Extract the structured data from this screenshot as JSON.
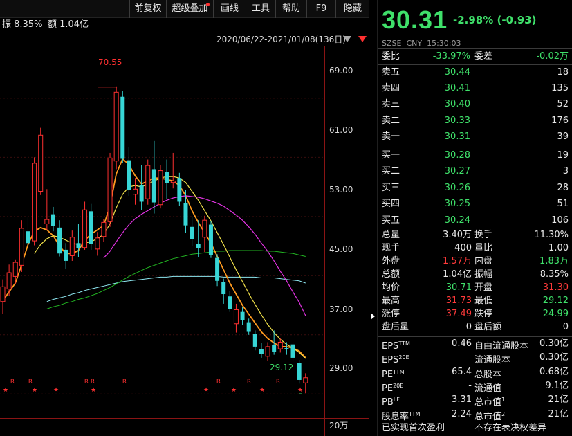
{
  "toolbar": {
    "buttons": [
      "前复权",
      "超级叠加",
      "画线",
      "工具",
      "帮助",
      "F9",
      "隐藏"
    ]
  },
  "info": {
    "amplitude": "振 8.35%",
    "amount": "额 1.04亿"
  },
  "range": {
    "text": "2020/06/22-2021/01/08(136日)"
  },
  "chart_data": {
    "type": "candlestick",
    "y_ticks": [
      "69.00",
      "61.00",
      "53.00",
      "45.00",
      "37.00",
      "29.00"
    ],
    "y_tick_values": [
      69,
      61,
      53,
      45,
      37,
      29
    ],
    "ylim": [
      25.75,
      76.1
    ],
    "high_label": "70.55",
    "low_label": "29.12",
    "volume_tick": "20万",
    "markers_r": [
      "R",
      "R",
      "R",
      "R",
      "R",
      "R",
      "R",
      "R",
      "R"
    ],
    "markers_star": [
      "★",
      "★",
      "★",
      "★",
      "★",
      "★",
      "★"
    ],
    "candles": [
      {
        "o": 41.5,
        "h": 44.5,
        "l": 39.8,
        "c": 43.5
      },
      {
        "o": 43.2,
        "h": 46.5,
        "l": 42.3,
        "c": 45.4
      },
      {
        "o": 44.9,
        "h": 47.2,
        "l": 43.8,
        "c": 46.8
      },
      {
        "o": 46.4,
        "h": 52.5,
        "l": 45.5,
        "c": 51.4
      },
      {
        "o": 51.0,
        "h": 53.0,
        "l": 48.9,
        "c": 49.4
      },
      {
        "o": 49.7,
        "h": 61.0,
        "l": 49.1,
        "c": 60.2
      },
      {
        "o": 56.4,
        "h": 65.0,
        "l": 55.9,
        "c": 64.0
      },
      {
        "o": 52.0,
        "h": 56.7,
        "l": 51.2,
        "c": 52.6
      },
      {
        "o": 53.3,
        "h": 54.3,
        "l": 51.0,
        "c": 51.7
      },
      {
        "o": 51.5,
        "h": 52.5,
        "l": 47.6,
        "c": 48.0
      },
      {
        "o": 48.5,
        "h": 49.4,
        "l": 45.9,
        "c": 47.0
      },
      {
        "o": 47.7,
        "h": 51.1,
        "l": 47.0,
        "c": 50.2
      },
      {
        "o": 49.4,
        "h": 52.0,
        "l": 47.5,
        "c": 48.7
      },
      {
        "o": 48.8,
        "h": 55.0,
        "l": 48.5,
        "c": 53.9
      },
      {
        "o": 53.7,
        "h": 54.7,
        "l": 48.5,
        "c": 49.3
      },
      {
        "o": 48.6,
        "h": 50.9,
        "l": 47.7,
        "c": 50.1
      },
      {
        "o": 50.3,
        "h": 52.7,
        "l": 49.6,
        "c": 52.2
      },
      {
        "o": 52.3,
        "h": 61.6,
        "l": 51.6,
        "c": 60.9
      },
      {
        "o": 60.5,
        "h": 70.6,
        "l": 59.4,
        "c": 69.8
      },
      {
        "o": 69.2,
        "h": 70.0,
        "l": 60.2,
        "c": 60.8
      },
      {
        "o": 60.6,
        "h": 62.4,
        "l": 55.8,
        "c": 56.6
      },
      {
        "o": 56.0,
        "h": 58.2,
        "l": 54.6,
        "c": 56.7
      },
      {
        "o": 57.2,
        "h": 60.0,
        "l": 53.9,
        "c": 55.0
      },
      {
        "o": 55.4,
        "h": 60.7,
        "l": 54.6,
        "c": 59.9
      },
      {
        "o": 59.4,
        "h": 63.2,
        "l": 53.4,
        "c": 54.9
      },
      {
        "o": 54.6,
        "h": 60.0,
        "l": 54.1,
        "c": 59.2
      },
      {
        "o": 59.0,
        "h": 60.7,
        "l": 55.4,
        "c": 57.5
      },
      {
        "o": 57.6,
        "h": 61.6,
        "l": 56.8,
        "c": 57.8
      },
      {
        "o": 58.2,
        "h": 58.9,
        "l": 54.4,
        "c": 55.0
      },
      {
        "o": 54.8,
        "h": 56.6,
        "l": 50.8,
        "c": 51.8
      },
      {
        "o": 51.6,
        "h": 53.0,
        "l": 49.0,
        "c": 49.9
      },
      {
        "o": 49.3,
        "h": 52.5,
        "l": 47.5,
        "c": 48.7
      },
      {
        "o": 50.2,
        "h": 53.1,
        "l": 48.2,
        "c": 52.5
      },
      {
        "o": 51.9,
        "h": 52.4,
        "l": 47.4,
        "c": 47.8
      },
      {
        "o": 47.4,
        "h": 47.9,
        "l": 43.6,
        "c": 44.3
      },
      {
        "o": 44.1,
        "h": 44.6,
        "l": 41.2,
        "c": 42.5
      },
      {
        "o": 42.2,
        "h": 42.9,
        "l": 40.1,
        "c": 40.5
      },
      {
        "o": 38.5,
        "h": 41.2,
        "l": 37.3,
        "c": 40.4
      },
      {
        "o": 40.1,
        "h": 40.8,
        "l": 38.3,
        "c": 39.0
      },
      {
        "o": 38.7,
        "h": 39.2,
        "l": 37.0,
        "c": 37.4
      },
      {
        "o": 37.1,
        "h": 37.6,
        "l": 34.9,
        "c": 35.4
      },
      {
        "o": 35.1,
        "h": 35.9,
        "l": 33.9,
        "c": 34.4
      },
      {
        "o": 34.1,
        "h": 36.0,
        "l": 33.5,
        "c": 35.4
      },
      {
        "o": 35.6,
        "h": 37.6,
        "l": 34.3,
        "c": 34.7
      },
      {
        "o": 35.1,
        "h": 36.5,
        "l": 34.6,
        "c": 36.0
      },
      {
        "o": 35.2,
        "h": 36.0,
        "l": 34.3,
        "c": 35.1
      },
      {
        "o": 35.7,
        "h": 36.0,
        "l": 33.4,
        "c": 33.9
      },
      {
        "o": 33.2,
        "h": 33.6,
        "l": 30.4,
        "c": 30.9
      },
      {
        "o": 30.5,
        "h": 31.8,
        "l": 29.1,
        "c": 31.2
      }
    ],
    "ma_series": [
      {
        "name": "ma-orange",
        "color": "#ff9a1f",
        "values": [
          41.6,
          42.8,
          44.0,
          46.5,
          49.2,
          51.0,
          51.5,
          51.2,
          50.4,
          49.0,
          48.0,
          48.0,
          48.4,
          49.8,
          50.6,
          51.2,
          51.8,
          54.4,
          58.8,
          60.8,
          60.0,
          58.5,
          57.4,
          57.8,
          58.2,
          58.2,
          58.0,
          57.8,
          57.2,
          55.8,
          53.8,
          52.2,
          50.8,
          49.4,
          47.6,
          45.8,
          44.0,
          42.5,
          41.0,
          39.8,
          38.6,
          37.4,
          36.5,
          35.9,
          35.4,
          35.4,
          35.2,
          34.8,
          33.9
        ]
      },
      {
        "name": "ma-yellow",
        "color": "#f2e24a",
        "values": [
          null,
          null,
          null,
          null,
          null,
          48.0,
          49.2,
          50.0,
          50.4,
          50.2,
          49.8,
          49.4,
          49.2,
          49.4,
          49.6,
          50.0,
          50.6,
          52.0,
          54.2,
          56.0,
          57.0,
          57.2,
          57.0,
          57.4,
          57.8,
          58.2,
          58.4,
          58.4,
          58.2,
          57.6,
          56.4,
          55.2,
          53.8,
          52.4,
          50.8,
          49.2,
          47.5,
          45.8,
          44.2,
          42.6,
          41.1,
          39.7,
          38.4,
          37.3,
          36.4,
          35.7,
          35.2,
          34.6,
          33.8
        ]
      },
      {
        "name": "ma-magenta",
        "color": "#e433e4",
        "values": [
          null,
          null,
          null,
          null,
          null,
          null,
          null,
          null,
          null,
          null,
          null,
          null,
          null,
          null,
          null,
          null,
          47.4,
          48.3,
          49.6,
          50.8,
          51.9,
          52.7,
          53.3,
          53.8,
          54.3,
          54.8,
          55.2,
          55.5,
          55.7,
          55.8,
          55.7,
          55.6,
          55.4,
          55.1,
          54.8,
          54.4,
          53.8,
          53.2,
          52.5,
          51.6,
          50.6,
          49.4,
          48.3,
          47.0,
          45.6,
          44.3,
          42.8,
          41.4,
          39.6
        ]
      },
      {
        "name": "ma-green",
        "color": "#22b422",
        "values": [
          null,
          null,
          null,
          null,
          null,
          null,
          null,
          null,
          null,
          null,
          null,
          null,
          null,
          null,
          null,
          null,
          null,
          null,
          null,
          null,
          null,
          null,
          null,
          null,
          43.0,
          43.6,
          44.2,
          44.8,
          45.4,
          45.9,
          46.3,
          46.7,
          47.0,
          47.2,
          47.4,
          47.6,
          47.8,
          47.9,
          48.0,
          48.1,
          48.2,
          48.2,
          48.2,
          48.2,
          48.1,
          48.0,
          47.9,
          47.7,
          47.5
        ]
      },
      {
        "name": "ma-cyan",
        "color": "#8ee6f0",
        "values": [
          null,
          null,
          null,
          null,
          null,
          null,
          null,
          null,
          null,
          null,
          null,
          null,
          null,
          null,
          null,
          null,
          null,
          null,
          null,
          null,
          null,
          null,
          null,
          null,
          null,
          null,
          null,
          null,
          null,
          null,
          null,
          null,
          null,
          null,
          null,
          null,
          null,
          null,
          null,
          null,
          null,
          null,
          null,
          null,
          44.6,
          44.5,
          44.4,
          44.3,
          44.0
        ]
      }
    ],
    "ma_cyan_full": [
      null,
      null,
      null,
      null,
      null,
      null,
      null,
      41.5,
      41.8,
      42.0,
      42.2,
      42.5,
      42.7,
      43.0,
      43.2,
      43.4,
      43.6,
      43.8,
      44.0,
      44.2,
      44.3,
      44.4,
      44.5,
      44.6,
      44.7,
      44.8,
      44.8,
      44.9,
      44.9,
      44.9,
      44.9,
      44.9,
      44.9,
      44.9,
      44.9,
      44.8,
      44.8,
      44.8,
      44.8,
      44.8,
      44.8,
      44.7,
      44.7,
      44.7,
      44.6,
      44.5,
      44.4,
      44.3,
      44.0
    ],
    "ma_green_full": [
      null,
      null,
      null,
      null,
      null,
      null,
      null,
      40.5,
      40.8,
      41.0,
      41.3,
      41.5,
      41.8,
      42.0,
      42.3,
      42.6,
      43.0,
      43.4,
      43.9,
      44.4,
      44.9,
      45.3,
      45.7,
      46.1,
      46.4,
      46.7,
      47.0,
      47.3,
      47.5,
      47.7,
      47.9,
      48.0,
      48.1,
      48.2,
      48.3,
      48.3,
      48.4,
      48.4,
      48.4,
      48.4,
      48.4,
      48.4,
      48.3,
      48.3,
      48.2,
      48.1,
      48.0,
      47.8,
      47.6
    ]
  },
  "quote": {
    "price": "30.31",
    "change": "-2.98% (-0.93)",
    "meta": "SZSE  CNY  15:30:03",
    "weibi_label": "委比",
    "weibi_value": "-33.97%",
    "weicha_label": "委差",
    "weicha_value": "-0.02万",
    "asks": [
      {
        "label": "卖五",
        "price": "30.44",
        "vol": "18"
      },
      {
        "label": "卖四",
        "price": "30.41",
        "vol": "135"
      },
      {
        "label": "卖三",
        "price": "30.40",
        "vol": "52"
      },
      {
        "label": "卖二",
        "price": "30.33",
        "vol": "176"
      },
      {
        "label": "卖一",
        "price": "30.31",
        "vol": "39"
      }
    ],
    "bids": [
      {
        "label": "买一",
        "price": "30.28",
        "vol": "19"
      },
      {
        "label": "买二",
        "price": "30.27",
        "vol": "3"
      },
      {
        "label": "买三",
        "price": "30.26",
        "vol": "28"
      },
      {
        "label": "买四",
        "price": "30.25",
        "vol": "51"
      },
      {
        "label": "买五",
        "price": "30.24",
        "vol": "106"
      }
    ],
    "stats": [
      {
        "l1": "总量",
        "v1": "3.40万",
        "c1": "w",
        "l2": "换手",
        "v2": "11.30%",
        "c2": "w"
      },
      {
        "l1": "现手",
        "v1": "400",
        "c1": "w",
        "l2": "量比",
        "v2": "1.00",
        "c2": "w"
      },
      {
        "l1": "外盘",
        "v1": "1.57万",
        "c1": "r",
        "l2": "内盘",
        "v2": "1.83万",
        "c2": "g"
      },
      {
        "l1": "总额",
        "v1": "1.04亿",
        "c1": "w",
        "l2": "振幅",
        "v2": "8.35%",
        "c2": "w"
      },
      {
        "l1": "均价",
        "v1": "30.71",
        "c1": "g",
        "l2": "开盘",
        "v2": "31.30",
        "c2": "r"
      },
      {
        "l1": "最高",
        "v1": "31.73",
        "c1": "r",
        "l2": "最低",
        "v2": "29.12",
        "c2": "g"
      },
      {
        "l1": "涨停",
        "v1": "37.49",
        "c1": "r",
        "l2": "跌停",
        "v2": "24.99",
        "c2": "g"
      },
      {
        "l1": "盘后量",
        "v1": "0",
        "c1": "w",
        "l2": "盘后额",
        "v2": "0",
        "c2": "w"
      }
    ],
    "fundamentals": [
      {
        "l1": "EPS",
        "s1": "TTM",
        "v1": "0.46",
        "l2": "自由流通股本",
        "s2": "",
        "v2": "0.30亿"
      },
      {
        "l1": "EPS",
        "s1": "20E",
        "v1": "",
        "l2": "流通股本",
        "s2": "",
        "v2": "0.30亿"
      },
      {
        "l1": "PE",
        "s1": "TTM",
        "v1": "65.4",
        "l2": "总股本",
        "s2": "",
        "v2": "0.68亿"
      },
      {
        "l1": "PE",
        "s1": "20E",
        "v1": "-",
        "l2": "流通值",
        "s2": "",
        "v2": "9.1亿"
      },
      {
        "l1": "PB",
        "s1": "LF",
        "v1": "3.31",
        "l2": "总市值",
        "s2": "1",
        "v2": "21亿"
      },
      {
        "l1": "股息率",
        "s1": "TTM",
        "v1": "2.24",
        "l2": "总市值",
        "s2": "2",
        "v2": "21亿"
      }
    ],
    "footer_left": "已实现首次盈利",
    "footer_right": "不存在表决权差异"
  }
}
